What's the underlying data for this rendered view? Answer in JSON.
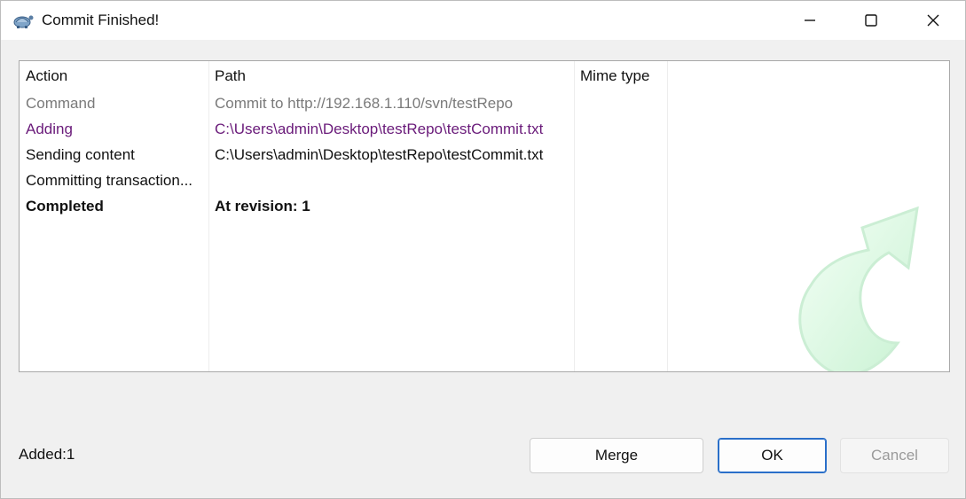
{
  "window": {
    "title": "Commit Finished!",
    "app_icon": "tortoise-icon",
    "controls": {
      "minimize_icon": "minimize-icon",
      "maximize_icon": "maximize-icon",
      "close_icon": "close-icon"
    }
  },
  "table": {
    "columns": [
      "Action",
      "Path",
      "Mime type"
    ],
    "rows": [
      {
        "action": "Command",
        "path": "Commit to http://192.168.1.110/svn/testRepo",
        "color": "#7a7a7a",
        "bold": false
      },
      {
        "action": "Adding",
        "path": "C:\\Users\\admin\\Desktop\\testRepo\\testCommit.txt",
        "color": "#6a1b7a",
        "bold": false
      },
      {
        "action": "Sending content",
        "path": "C:\\Users\\admin\\Desktop\\testRepo\\testCommit.txt",
        "color": "#111111",
        "bold": false
      },
      {
        "action": "Committing transaction...",
        "path": "",
        "color": "#111111",
        "bold": false
      },
      {
        "action": "Completed",
        "path": "At revision: 1",
        "color": "#111111",
        "bold": true
      }
    ],
    "watermark_icon": "commit-arrow-icon"
  },
  "status": {
    "text": "Added:1"
  },
  "buttons": {
    "merge": "Merge",
    "ok": "OK",
    "cancel": "Cancel"
  }
}
